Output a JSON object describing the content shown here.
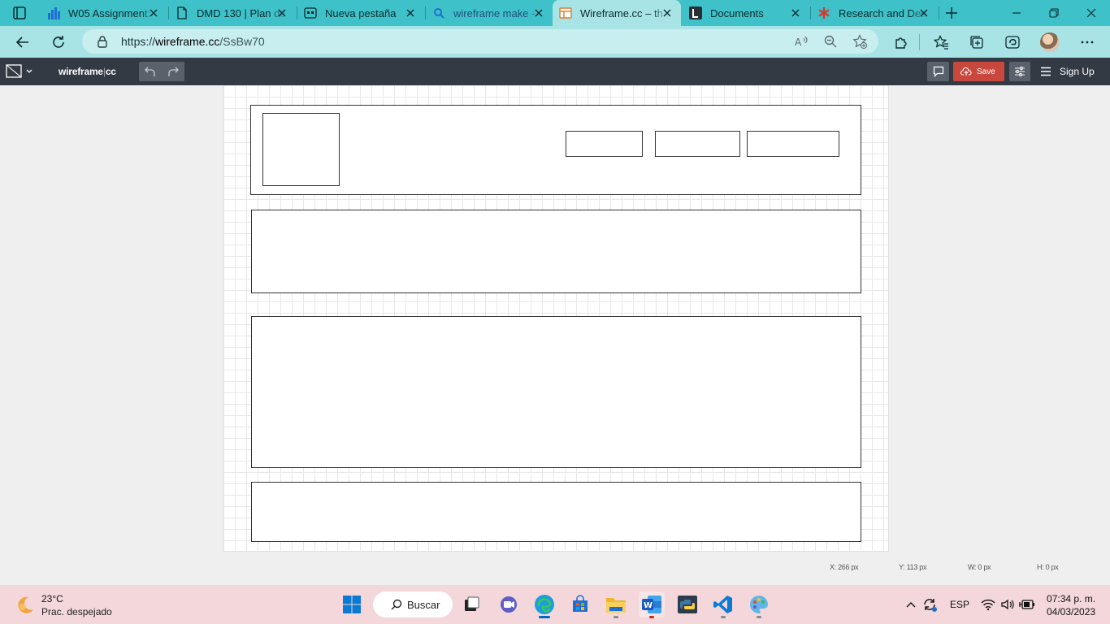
{
  "browser": {
    "tabs": [
      {
        "title": "W05 Assignment: ",
        "icon": "chart-bars-icon"
      },
      {
        "title": "DMD 130 | Plan de",
        "icon": "document-icon"
      },
      {
        "title": "Nueva pestaña",
        "icon": "newtab-page-icon"
      },
      {
        "title": "wireframe make - ",
        "icon": "search-icon"
      },
      {
        "title": "Wireframe.cc – th",
        "icon": "wireframe-site-icon",
        "active": true
      },
      {
        "title": "Documents",
        "icon": "documents-site-icon"
      },
      {
        "title": "Research and Des",
        "icon": "asterisk-icon"
      }
    ],
    "address": {
      "scheme": "https://",
      "host": "wireframe.cc",
      "path": "/SsBw70"
    }
  },
  "app": {
    "brand": "wireframe",
    "brand_suffix": "cc",
    "save_label": "Save",
    "signup_label": "Sign Up"
  },
  "status": {
    "x": "X: 266 px",
    "y": "Y: 113 px",
    "w": "W: 0 px",
    "h": "H: 0 px"
  },
  "taskbar": {
    "temp": "23°C",
    "weather": "Prac. despejado",
    "search_label": "Buscar",
    "lang": "ESP",
    "time": "07:34 p. m.",
    "date": "04/03/2023"
  },
  "colors": {
    "tabstrip": "#3fc1c9",
    "toolbar": "#333a44",
    "save": "#c9483e",
    "taskbar": "#f3d7db"
  }
}
